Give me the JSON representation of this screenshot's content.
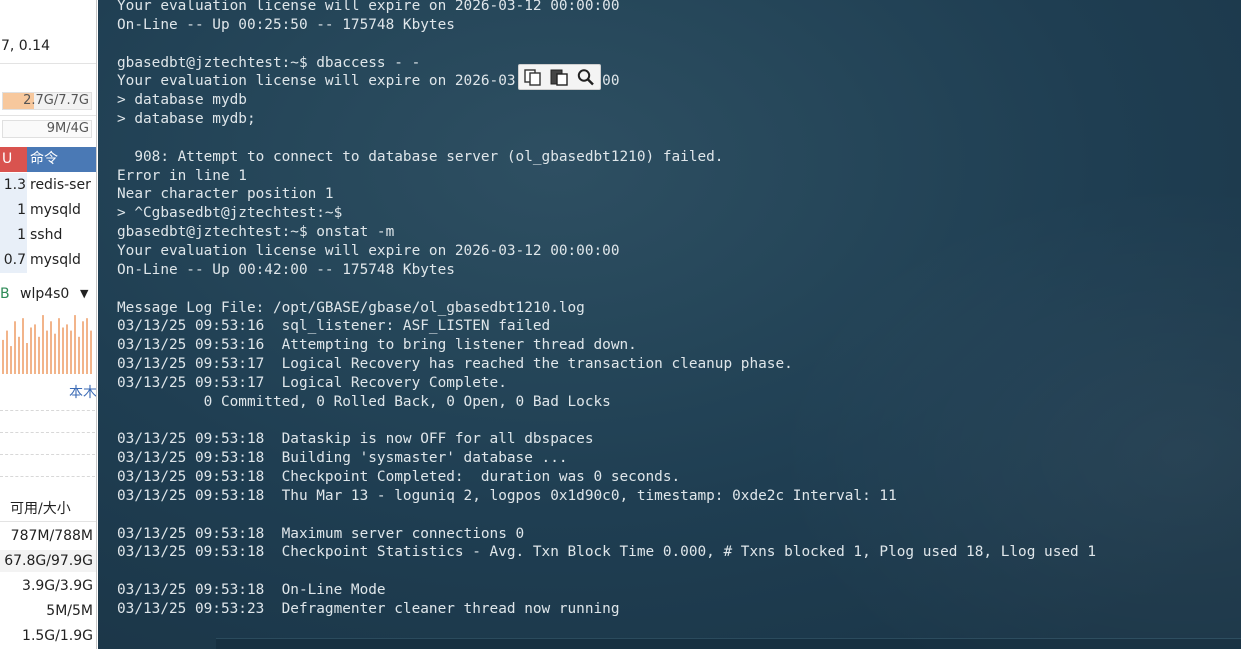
{
  "left_panel": {
    "load_text": "7, 0.14",
    "mem_bar": {
      "label": "2.7G/7.7G",
      "fill_fraction": 0.35,
      "fill_color": "#f7c89d"
    },
    "swap_bar": {
      "label": "9M/4G",
      "fill_fraction": 0.0,
      "fill_color": "#f7c89d"
    },
    "process_table": {
      "header_cpu": "U",
      "header_cmd": "命令",
      "rows": [
        {
          "cpu": "1.3",
          "cmd": "redis-ser"
        },
        {
          "cpu": "1",
          "cmd": "mysqld"
        },
        {
          "cpu": "1",
          "cmd": "sshd"
        },
        {
          "cpu": "0.7",
          "cmd": "mysqld"
        }
      ]
    },
    "network": {
      "prefix": "B",
      "interface": "wlp4s0",
      "caret": "▼",
      "graph_color": "#f2b48a"
    },
    "local_link": "本木",
    "disk_table": {
      "header": "可用/大小",
      "rows": [
        {
          "value": "787M/788M"
        },
        {
          "value": "67.8G/97.9G"
        },
        {
          "value": "3.9G/3.9G"
        },
        {
          "value": "5M/5M"
        },
        {
          "value": "1.5G/1.9G"
        }
      ]
    }
  },
  "terminal": {
    "lines": [
      "Your evaluation license will expire on 2026-03-12 00:00:00",
      "On-Line -- Up 00:25:50 -- 175748 Kbytes",
      "",
      "gbasedbt@jztechtest:~$ dbaccess - -",
      "Your evaluation license will expire on 2026-03-12 00:00:00",
      "> database mydb",
      "> database mydb;",
      "",
      "  908: Attempt to connect to database server (ol_gbasedbt1210) failed.",
      "Error in line 1",
      "Near character position 1",
      "> ^Cgbasedbt@jztechtest:~$",
      "gbasedbt@jztechtest:~$ onstat -m",
      "Your evaluation license will expire on 2026-03-12 00:00:00",
      "On-Line -- Up 00:42:00 -- 175748 Kbytes",
      "",
      "Message Log File: /opt/GBASE/gbase/ol_gbasedbt1210.log",
      "03/13/25 09:53:16  sql_listener: ASF_LISTEN failed",
      "03/13/25 09:53:16  Attempting to bring listener thread down.",
      "03/13/25 09:53:17  Logical Recovery has reached the transaction cleanup phase.",
      "03/13/25 09:53:17  Logical Recovery Complete.",
      "          0 Committed, 0 Rolled Back, 0 Open, 0 Bad Locks",
      "",
      "03/13/25 09:53:18  Dataskip is now OFF for all dbspaces",
      "03/13/25 09:53:18  Building 'sysmaster' database ...",
      "03/13/25 09:53:18  Checkpoint Completed:  duration was 0 seconds.",
      "03/13/25 09:53:18  Thu Mar 13 - loguniq 2, logpos 0x1d90c0, timestamp: 0xde2c Interval: 11",
      "",
      "03/13/25 09:53:18  Maximum server connections 0",
      "03/13/25 09:53:18  Checkpoint Statistics - Avg. Txn Block Time 0.000, # Txns blocked 1, Plog used 18, Llog used 1",
      "",
      "03/13/25 09:53:18  On-Line Mode",
      "03/13/25 09:53:23  Defragmenter cleaner thread now running"
    ],
    "colors": {
      "text": "#dfe6ea",
      "background": "#26475a"
    }
  },
  "float_toolbar": {
    "buttons": [
      {
        "icon": "copy-icon"
      },
      {
        "icon": "paste-icon"
      },
      {
        "icon": "search-icon"
      }
    ]
  }
}
